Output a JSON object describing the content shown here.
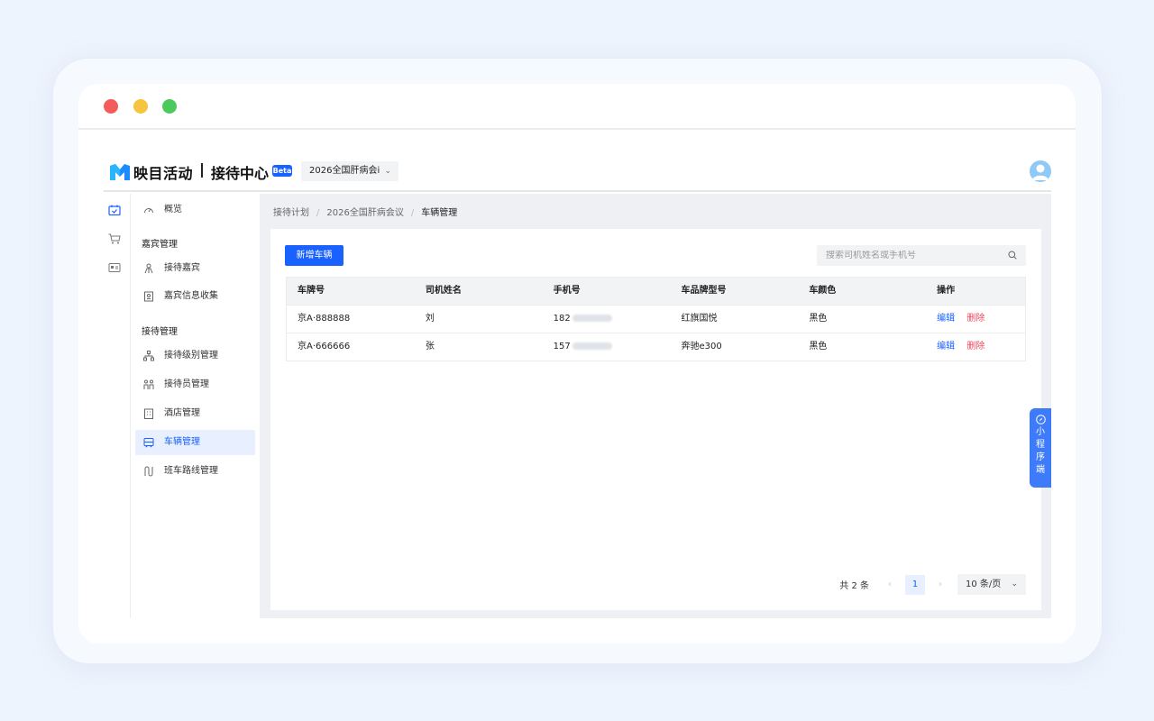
{
  "app": {
    "brand": "映目活动",
    "module": "接待中心",
    "badge": "Beta",
    "event_selector": "2026全国肝病会i",
    "avatar_icon": "user-avatar-icon"
  },
  "rail": {
    "icons": [
      "calendar-check-icon",
      "cart-icon",
      "id-card-icon"
    ]
  },
  "sidebar": {
    "overview": "概览",
    "group_guest": "嘉宾管理",
    "receive_guest": "接待嘉宾",
    "guest_info": "嘉宾信息收集",
    "group_reception": "接待管理",
    "level": "接待级别管理",
    "staff": "接待员管理",
    "hotel": "酒店管理",
    "vehicle": "车辆管理",
    "route": "班车路线管理"
  },
  "breadcrumb": {
    "level1": "接待计划",
    "level2": "2026全国肝病会议",
    "current": "车辆管理"
  },
  "toolbar": {
    "add_label": "新增车辆",
    "search_placeholder": "搜索司机姓名或手机号"
  },
  "table": {
    "headers": [
      "车牌号",
      "司机姓名",
      "手机号",
      "车品牌型号",
      "车颜色",
      "操作"
    ],
    "rows": [
      {
        "plate": "京A·888888",
        "driver": "刘",
        "phone": "182",
        "model": "红旗国悦",
        "color": "黑色"
      },
      {
        "plate": "京A·666666",
        "driver": "张",
        "phone": "157",
        "model": "奔驰e300",
        "color": "黑色"
      }
    ],
    "edit_label": "编辑",
    "delete_label": "删除"
  },
  "pagination": {
    "total": "共 2 条",
    "current_page": "1",
    "page_size": "10 条/页"
  },
  "mini_program_tab": "小\n程\n序\n端",
  "colors": {
    "primary": "#1a62ff",
    "danger": "#f5455c",
    "mac_red": "#f45b5b",
    "mac_yellow": "#f5c540",
    "mac_green": "#4bc95c"
  }
}
